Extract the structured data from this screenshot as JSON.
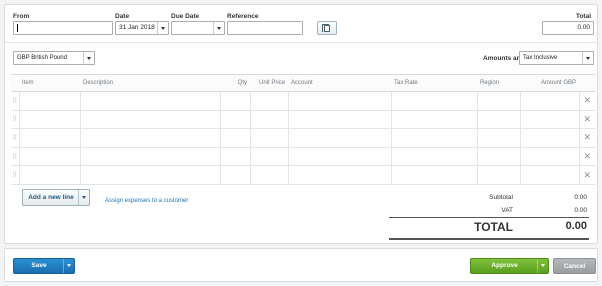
{
  "header": {
    "from_label": "From",
    "from_value": "",
    "date_label": "Date",
    "date_value": "31 Jan 2018",
    "due_date_label": "Due Date",
    "due_date_value": "",
    "reference_label": "Reference",
    "reference_value": "",
    "total_label": "Total",
    "total_value": "0.00"
  },
  "currency": {
    "selected": "GBP British Pound"
  },
  "amounts": {
    "label": "Amounts are",
    "selected": "Tax Inclusive"
  },
  "table": {
    "columns": [
      "Item",
      "Description",
      "Qty",
      "Unit Price",
      "Account",
      "Tax Rate",
      "Region",
      "Amount GBP"
    ],
    "row_count": 5,
    "handle_glyph": "⠿",
    "delete_glyph": "✕"
  },
  "actions": {
    "add_line_label": "Add a new line",
    "assign_link": "Assign expenses to a customer"
  },
  "totals": {
    "subtotal_label": "Subtotal",
    "subtotal_value": "0.00",
    "vat_label": "VAT",
    "vat_value": "0.00",
    "total_label": "TOTAL",
    "total_value": "0.00"
  },
  "footer": {
    "save_label": "Save",
    "approve_label": "Approve",
    "cancel_label": "Cancel"
  },
  "colors": {
    "save": "#1a6fb0",
    "approve": "#6aad2a",
    "cancel": "#a3a8ab",
    "link": "#1f76b4"
  }
}
